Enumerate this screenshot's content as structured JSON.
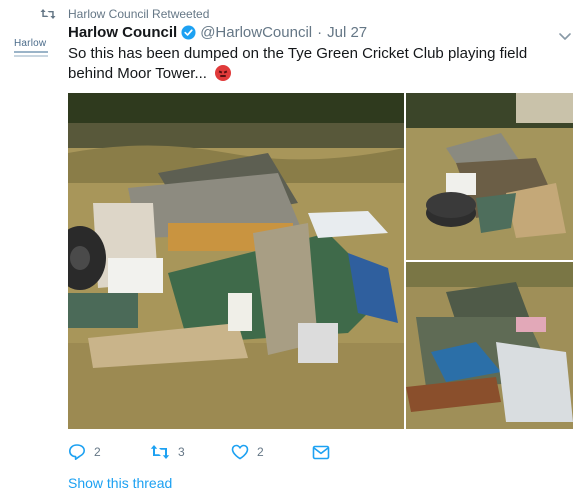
{
  "retweet_context": {
    "text": "Harlow Council Retweeted",
    "icon": "retweet-icon"
  },
  "avatar": {
    "label": "Harlow"
  },
  "tweet": {
    "author_name": "Harlow Council",
    "handle": "@HarlowCouncil",
    "separator": "·",
    "date": "Jul 27",
    "text": "So this has been dumped on the Tye Green Cricket Club playing field behind Moor Tower...",
    "emoji": "angry-face-emoji"
  },
  "media": {
    "count": 3
  },
  "actions": {
    "reply_count": "2",
    "retweet_count": "3",
    "like_count": "2"
  },
  "show_thread": "Show this thread",
  "colors": {
    "accent": "#1da1f2",
    "muted": "#657786",
    "text": "#14171a",
    "verified": "#1da1f2",
    "grass": "#a7924f",
    "trees": "#2f3a1e"
  }
}
